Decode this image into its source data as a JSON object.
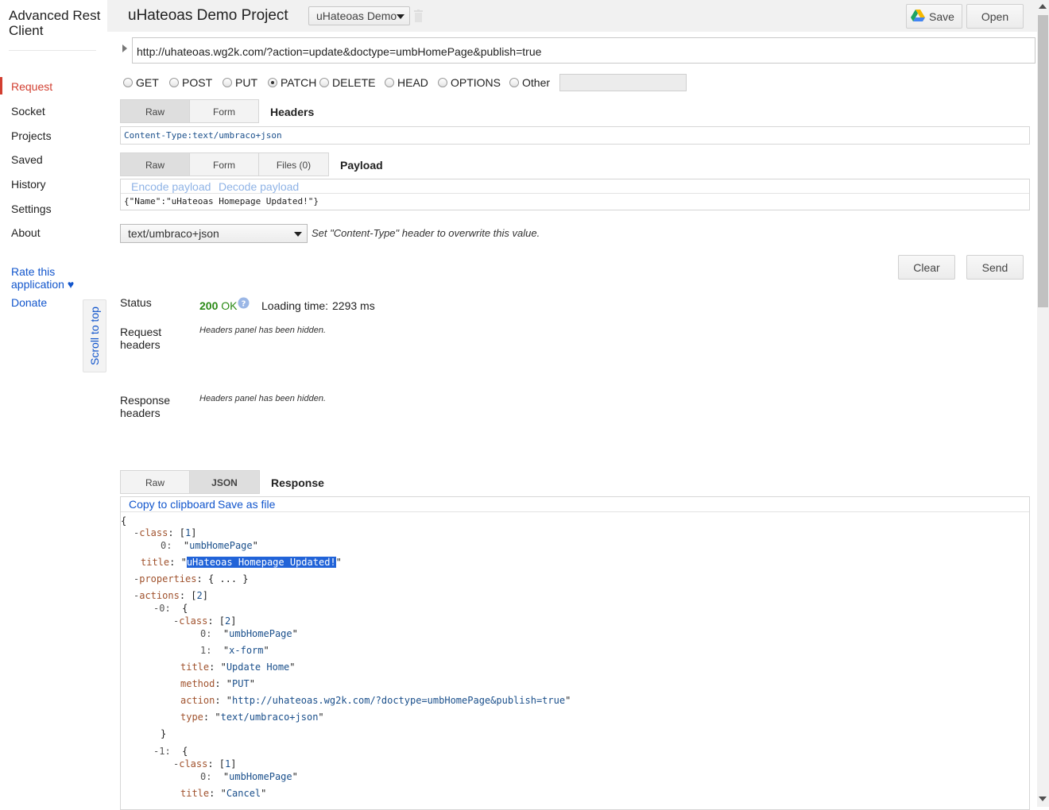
{
  "sidebar": {
    "app_title_line1": "Advanced Rest",
    "app_title_line2": "Client",
    "items": [
      "Request",
      "Socket",
      "Projects",
      "Saved",
      "History",
      "Settings",
      "About"
    ],
    "active_item": "Request",
    "rate_line1": "Rate this",
    "rate_line2": "application ♥",
    "donate": "Donate",
    "scroll_to_top": "Scroll to top"
  },
  "header": {
    "project_title": "uHateoas Demo Project",
    "project_select": "uHateoas Demo",
    "save_label": "Save",
    "open_label": "Open"
  },
  "request": {
    "url": "http://uhateoas.wg2k.com/?action=update&doctype=umbHomePage&publish=true",
    "methods": [
      "GET",
      "POST",
      "PUT",
      "PATCH",
      "DELETE",
      "HEAD",
      "OPTIONS",
      "Other"
    ],
    "selected_method": "PATCH",
    "headers_tabs": [
      "Raw",
      "Form"
    ],
    "headers_label": "Headers",
    "headers_raw": "Content-Type:text/umbraco+json",
    "payload_tabs": [
      "Raw",
      "Form",
      "Files (0)"
    ],
    "payload_label": "Payload",
    "encode_payload": "Encode payload",
    "decode_payload": "Decode payload",
    "payload_body": "{\"Name\":\"uHateoas Homepage Updated!\"}",
    "content_type": "text/umbraco+json",
    "content_type_note": "Set \"Content-Type\" header to overwrite this value.",
    "clear_label": "Clear",
    "send_label": "Send"
  },
  "response": {
    "status_label": "Status",
    "status_code": "200",
    "status_text": "OK",
    "loading_label": "Loading time:",
    "loading_value": "2293 ms",
    "request_headers_label_1": "Request",
    "request_headers_label_2": "headers",
    "request_headers_note": "Headers panel has been hidden.",
    "response_headers_label_1": "Response",
    "response_headers_label_2": "headers",
    "response_headers_note": "Headers panel has been hidden.",
    "tabs": [
      "Raw",
      "JSON"
    ],
    "selected_tab": "JSON",
    "response_label": "Response",
    "copy_label": "Copy to clipboard",
    "save_file_label": "Save as file",
    "json": {
      "open_brace": "{",
      "class_key": "class",
      "class_count": "1",
      "class_0": "umbHomePage",
      "title_key": "title",
      "title_value": "uHateoas Homepage Updated!",
      "properties_key": "properties",
      "properties_collapsed": "{ ... }",
      "actions_key": "actions",
      "actions_count": "2",
      "a0_index": "0",
      "a0_class_count": "2",
      "a0_class_0": "umbHomePage",
      "a0_class_1": "x-form",
      "a0_title": "Update Home",
      "a0_method": "PUT",
      "a0_action": "http://uhateoas.wg2k.com/?doctype=umbHomePage&publish=true",
      "a0_type": "text/umbraco+json",
      "a1_index": "1",
      "a1_class_count": "1",
      "a1_class_0": "umbHomePage",
      "a1_title": "Cancel"
    }
  }
}
